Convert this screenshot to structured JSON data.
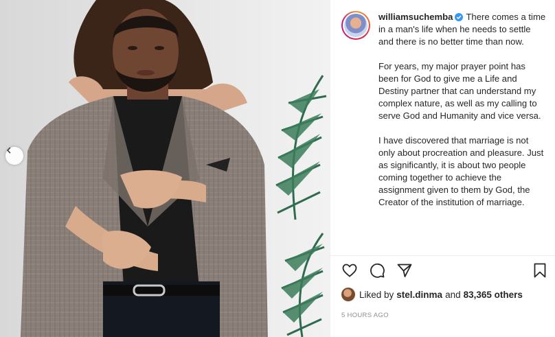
{
  "post": {
    "username": "williamsuchemba",
    "verified_badge": "verified-icon",
    "caption": [
      "There comes a time in a man's life when he needs to settle and there is no better time than now.",
      "For years, my major prayer point has been for God to give me a Life and Destiny partner that can understand my complex nature, as well as my calling to serve God and Humanity and vice versa.",
      "I have discovered that marriage is not only about procreation and pleasure. Just as significantly, it is about two people coming together to achieve the assignment given to them by God, the Creator of the institution of marriage."
    ],
    "likes": {
      "prefix": "Liked by",
      "user": "stel.dinma",
      "conjunction": "and",
      "others": "83,365 others"
    },
    "timestamp": "5 hours ago"
  },
  "icons": {
    "carousel_prev": "chevron-left-icon",
    "like": "heart-icon",
    "comment": "comment-icon",
    "share": "paper-plane-icon",
    "save": "bookmark-icon"
  },
  "colors": {
    "text": "#262626",
    "muted": "#8e8e8e",
    "verified": "#3897f0",
    "divider": "#efefef"
  }
}
